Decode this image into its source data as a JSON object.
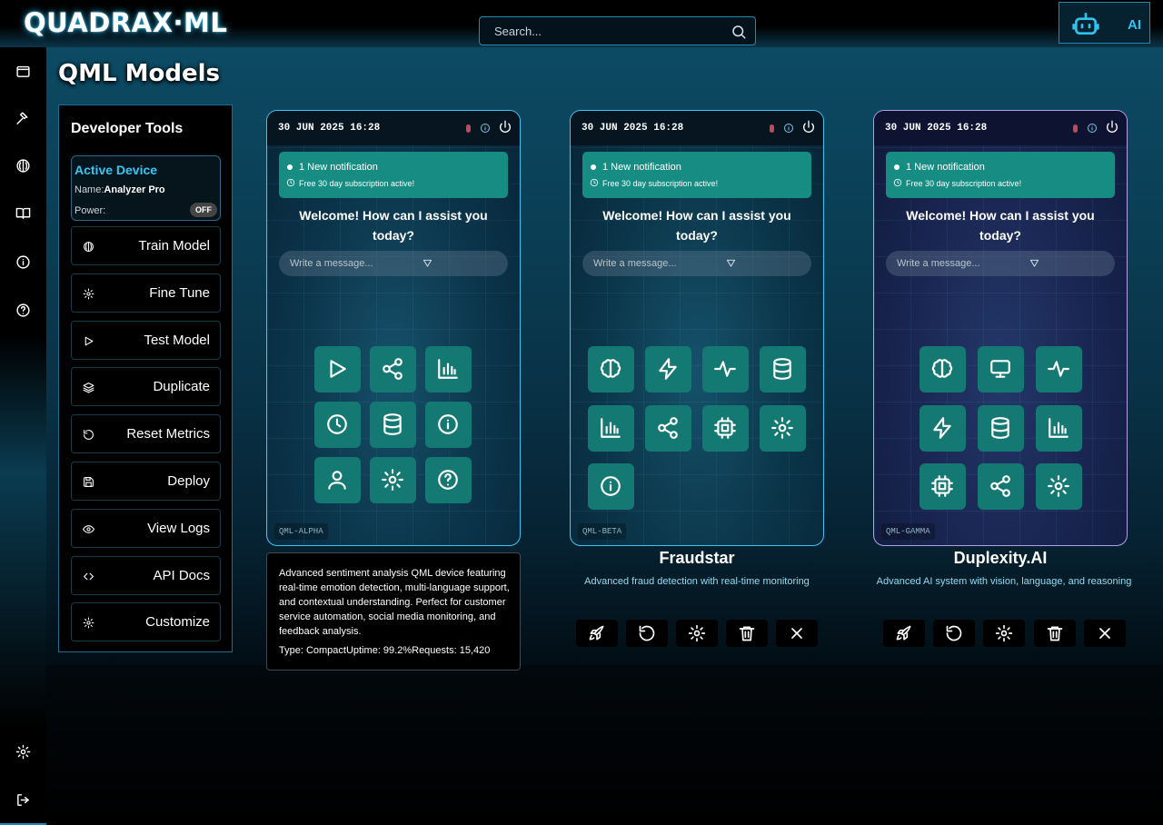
{
  "header": {
    "logo": "QUADRAX·ML",
    "search_placeholder": "Search...",
    "ai_label": "AI"
  },
  "page_title": "QML Models",
  "dev_tools": {
    "title": "Developer Tools",
    "active_device": {
      "title": "Active Device",
      "name_label": "Name:",
      "name_value": "Analyzer Pro",
      "power_label": "Power:",
      "power_state": "OFF"
    },
    "buttons": [
      {
        "label": "Train Model",
        "icon": "brain-icon"
      },
      {
        "label": "Fine Tune",
        "icon": "gear-icon"
      },
      {
        "label": "Test Model",
        "icon": "play-icon"
      },
      {
        "label": "Duplicate",
        "icon": "layers-icon"
      },
      {
        "label": "Reset Metrics",
        "icon": "reset-icon"
      },
      {
        "label": "Deploy",
        "icon": "save-icon"
      },
      {
        "label": "View Logs",
        "icon": "eye-icon"
      },
      {
        "label": "API Docs",
        "icon": "code-icon"
      },
      {
        "label": "Customize",
        "icon": "gear-icon"
      }
    ]
  },
  "devices": [
    {
      "time": "30 JUN 2025 16:28",
      "notification": "1 New notification",
      "subscription": "Free 30 day subscription active!",
      "welcome": "Welcome! How can I assist you today?",
      "message_placeholder": "Write a message...",
      "tag": "QML-ALPHA",
      "title": "",
      "description": "",
      "tiles": [
        "play-icon",
        "share-icon",
        "chart-icon",
        "clock-icon",
        "database-icon",
        "info-icon",
        "user-icon",
        "gear-icon",
        "help-icon"
      ]
    },
    {
      "time": "30 JUN 2025 16:28",
      "notification": "1 New notification",
      "subscription": "Free 30 day subscription active!",
      "welcome": "Welcome! How can I assist you today?",
      "message_placeholder": "Write a message...",
      "tag": "QML-BETA",
      "title": "Fraudstar",
      "description": "Advanced fraud detection with real-time monitoring",
      "tiles": [
        "brain-icon",
        "bolt-icon",
        "activity-icon",
        "database-icon",
        "chart-icon",
        "share-icon",
        "cpu-icon",
        "gear-icon",
        "info-icon"
      ]
    },
    {
      "time": "30 JUN 2025 16:28",
      "notification": "1 New notification",
      "subscription": "Free 30 day subscription active!",
      "welcome": "Welcome! How can I assist you today?",
      "message_placeholder": "Write a message...",
      "tag": "QML-GAMMA",
      "title": "Duplexity.AI",
      "description": "Advanced AI system with vision, language, and reasoning",
      "tiles": [
        "brain-icon",
        "monitor-icon",
        "activity-icon",
        "bolt-icon",
        "database-icon",
        "chart-icon",
        "cpu-icon",
        "share-icon",
        "gear-icon"
      ]
    }
  ],
  "tooltip": {
    "text": "Advanced sentiment analysis QML device featuring real-time emotion detection, multi-language support, and contextual understanding. Perfect for customer service automation, social media monitoring, and feedback analysis.",
    "stats": "Type: CompactUptime: 99.2%Requests: 15,420"
  },
  "action_icons": [
    "rocket-icon",
    "reset-icon",
    "gear-icon",
    "trash-icon",
    "close-icon"
  ],
  "colors": {
    "accent": "#2fc4f0",
    "tile": "#147873",
    "notification": "#168c82",
    "phone_border_blue": "#3dc4ee",
    "phone_border_purple": "#b4a0e8"
  }
}
